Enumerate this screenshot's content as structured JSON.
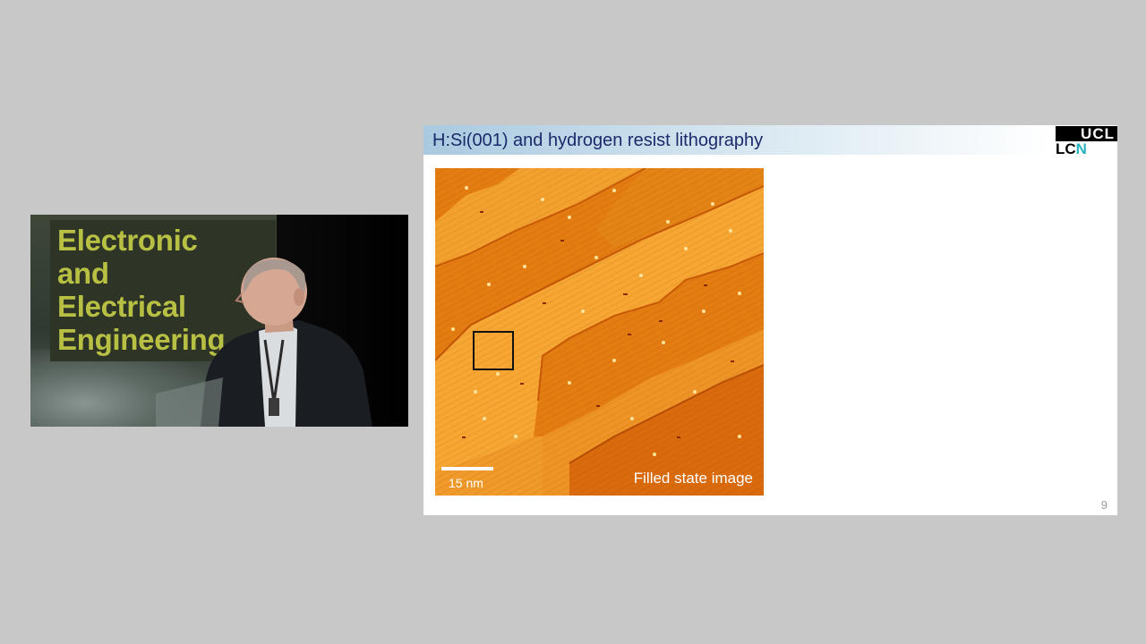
{
  "video": {
    "banner_text": "Electronic\nand\nElectrical\nEngineering"
  },
  "slide": {
    "title": "H:Si(001) and hydrogen resist lithography",
    "logo": {
      "ucl": "UCL",
      "lcn_lc": "LC",
      "lcn_n": "N"
    },
    "image": {
      "scale_label": "15 nm",
      "caption": "Filled state image"
    },
    "page_number": "9"
  },
  "colors": {
    "background": "#c8c8c8",
    "title_text": "#1b2a6b",
    "banner_text": "#b8c043",
    "terrace_light": "#f6a632",
    "terrace_dark": "#d96b0c",
    "lcn_accent": "#27b3c2"
  }
}
